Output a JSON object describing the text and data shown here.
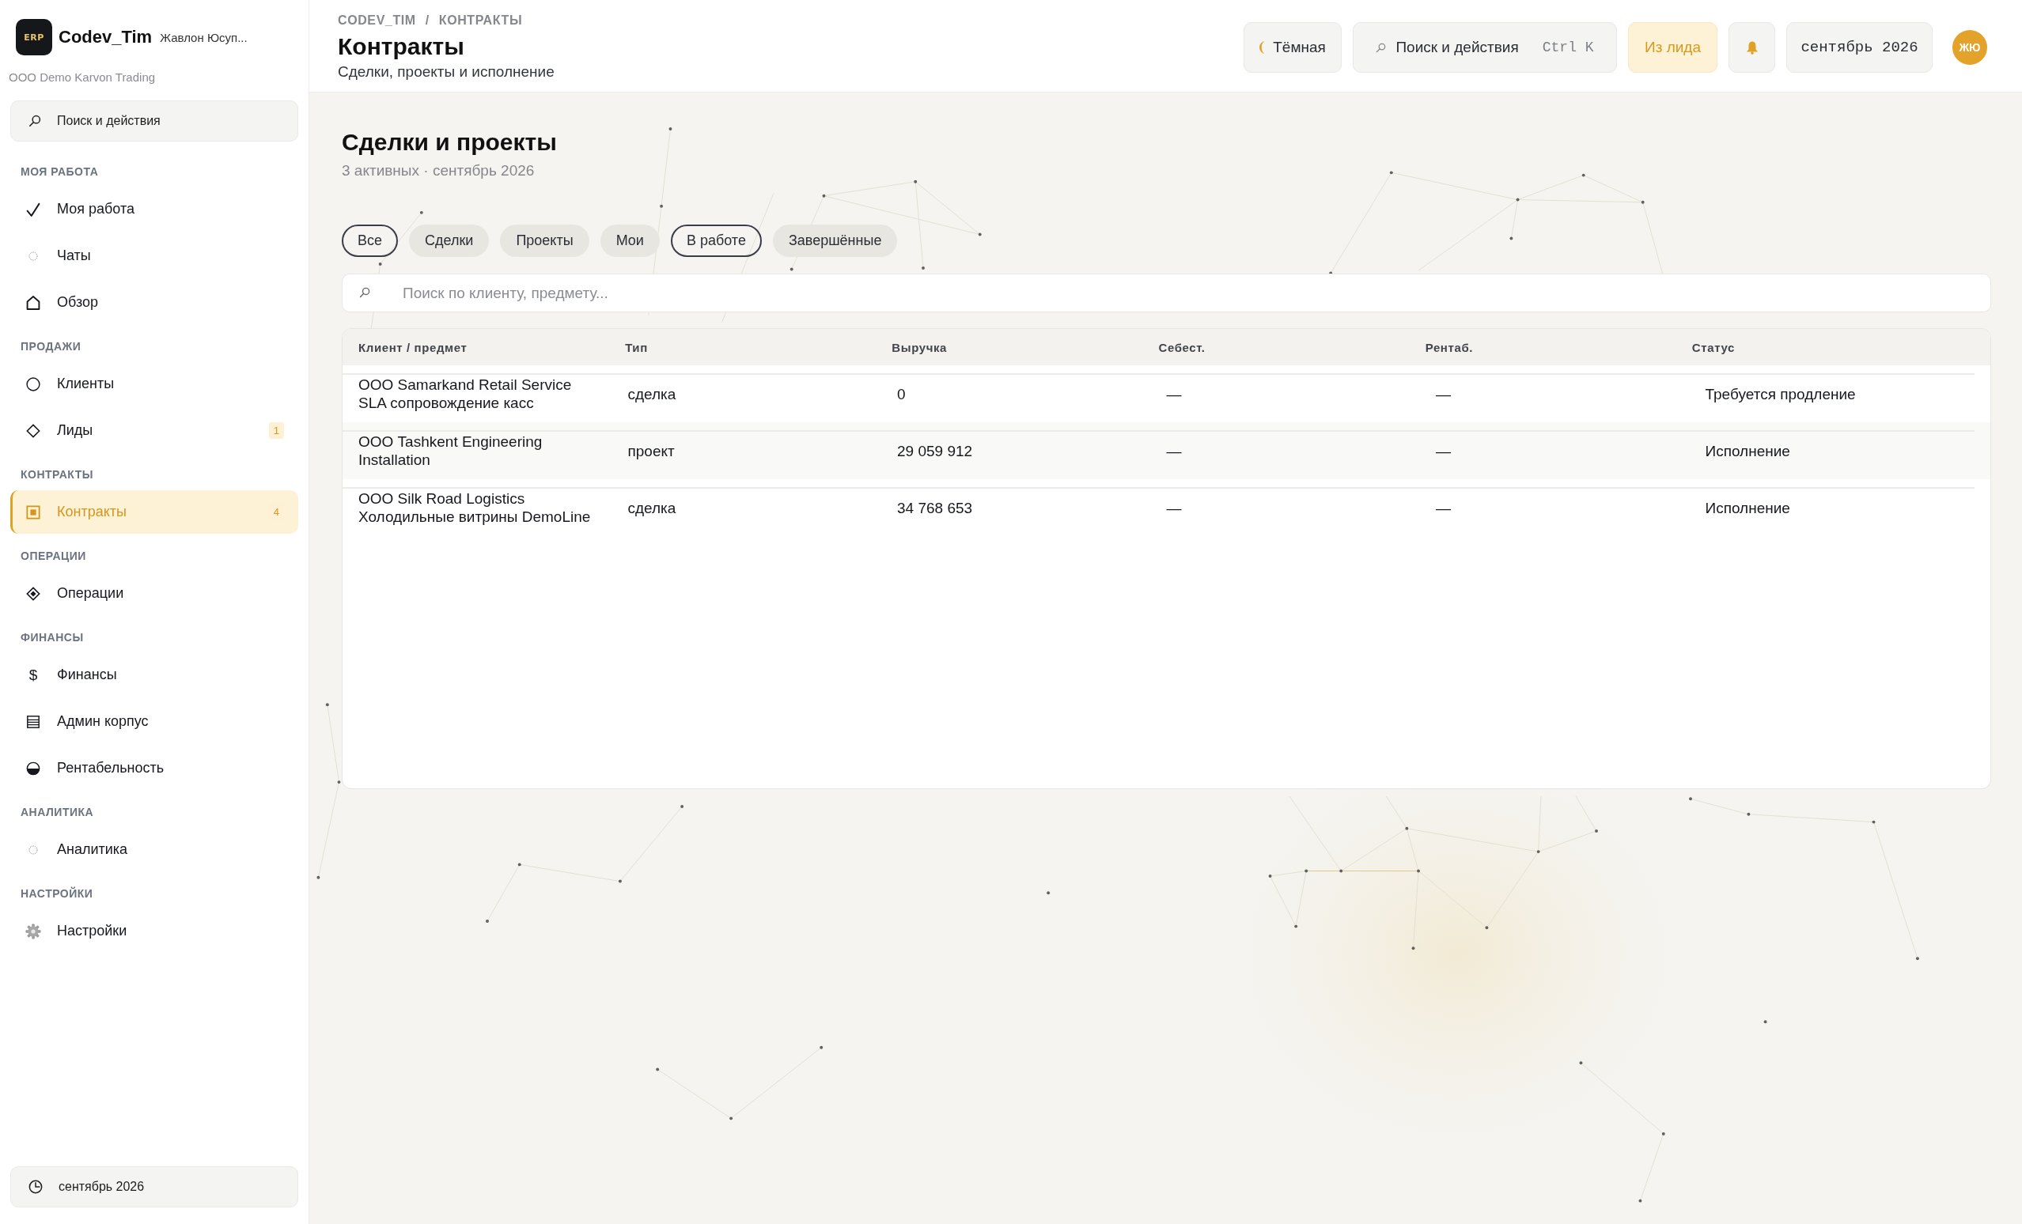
{
  "sidebar": {
    "brand": {
      "logo_text": "ERP",
      "name": "Codev_Tim",
      "user": "Жавлон Юсуп..."
    },
    "org": "ООО Demo Karvon Trading",
    "search": {
      "label": "Поиск и действия"
    },
    "sections": [
      {
        "title": "МОЯ РАБОТА",
        "items": [
          {
            "label": "Моя работа",
            "selected": false
          },
          {
            "label": "Чаты",
            "selected": false
          },
          {
            "label": "Обзор",
            "selected": false
          }
        ]
      },
      {
        "title": "ПРОДАЖИ",
        "items": [
          {
            "label": "Клиенты",
            "selected": false
          },
          {
            "label": "Лиды",
            "selected": false,
            "badge": "1"
          }
        ]
      },
      {
        "title": "КОНТРАКТЫ",
        "items": [
          {
            "label": "Контракты",
            "selected": true,
            "badge": "4"
          }
        ]
      },
      {
        "title": "ОПЕРАЦИИ",
        "items": [
          {
            "label": "Операции",
            "selected": false
          }
        ]
      },
      {
        "title": "ФИНАНСЫ",
        "items": [
          {
            "label": "Финансы",
            "selected": false,
            "icon_text": "$"
          },
          {
            "label": "Админ корпус",
            "selected": false
          },
          {
            "label": "Рентабельность",
            "selected": false
          }
        ]
      },
      {
        "title": "АНАЛИТИКА",
        "items": [
          {
            "label": "Аналитика",
            "selected": false
          }
        ]
      },
      {
        "title": "НАСТРОЙКИ",
        "items": [
          {
            "label": "Настройки",
            "selected": false
          }
        ]
      }
    ],
    "period": {
      "label": "сентябрь 2026"
    }
  },
  "header": {
    "breadcrumb": {
      "items": [
        "CODEV_TIM",
        "КОНТРАКТЫ"
      ],
      "separator": "/"
    },
    "title": "Контракты",
    "subtitle": "Сделки, проекты и исполнение",
    "theme_button": {
      "label": "Тёмная"
    },
    "search": {
      "label": "Поиск и действия",
      "shortcut": "Ctrl K"
    },
    "lead_button": {
      "label": "Из лида"
    },
    "period": {
      "label": "сентябрь 2026"
    },
    "avatar": {
      "initials": "ЖЮ"
    }
  },
  "content": {
    "title": "Сделки и проекты",
    "summary": "3 активных · сентябрь 2026",
    "filters": [
      {
        "label": "Все",
        "selected": true
      },
      {
        "label": "Сделки",
        "selected": false
      },
      {
        "label": "Проекты",
        "selected": false
      },
      {
        "label": "Мои",
        "selected": false
      },
      {
        "label": "В работе",
        "selected": true
      },
      {
        "label": "Завершённые",
        "selected": false
      }
    ],
    "search": {
      "placeholder": "Поиск по клиенту, предмету..."
    },
    "table": {
      "columns": [
        "Клиент / предмет",
        "Тип",
        "Выручка",
        "Себест.",
        "Рентаб.",
        "Статус"
      ],
      "rows": [
        {
          "client": "ООО Samarkand Retail Service",
          "subject": "SLA сопровождение касс",
          "type": "сделка",
          "revenue": "0",
          "cost": "—",
          "margin": "—",
          "status": "Требуется продление"
        },
        {
          "client": "ООО Tashkent Engineering",
          "subject": "Installation",
          "type": "проект",
          "revenue": "29 059 912",
          "cost": "—",
          "margin": "—",
          "status": "Исполнение"
        },
        {
          "client": "ООО Silk Road Logistics",
          "subject": "Холодильные витрины DemoLine",
          "type": "сделка",
          "revenue": "34 768 653",
          "cost": "—",
          "margin": "—",
          "status": "Исполнение"
        }
      ]
    }
  }
}
